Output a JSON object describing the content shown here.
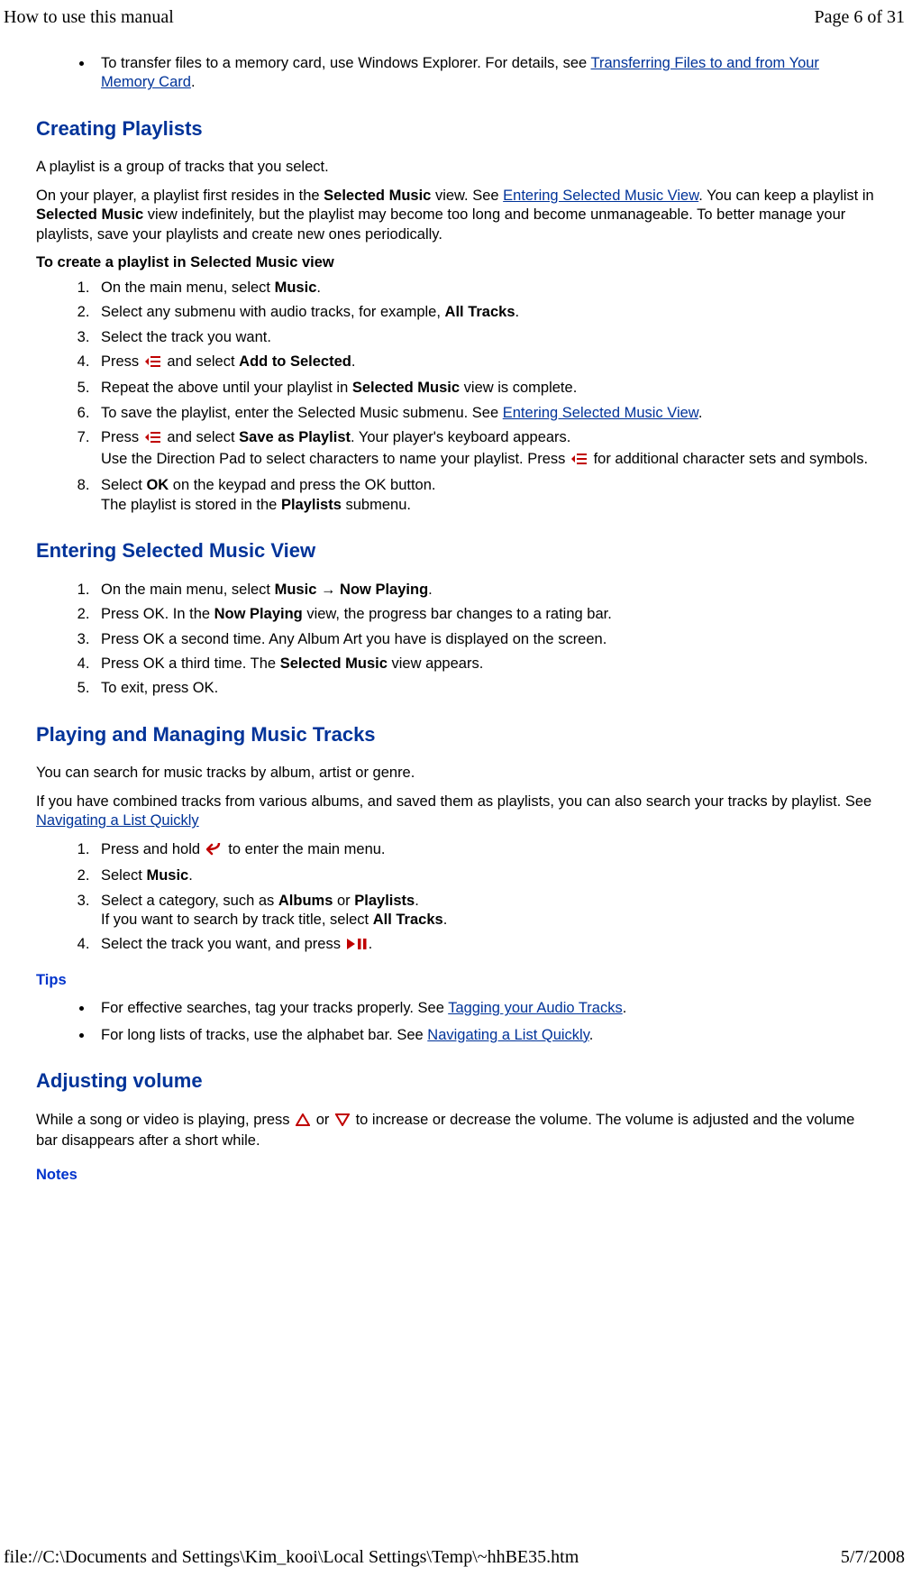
{
  "header": {
    "title": "How to use this manual",
    "page": "Page 6 of 31"
  },
  "footer": {
    "path": "file://C:\\Documents and Settings\\Kim_kooi\\Local Settings\\Temp\\~hhBE35.htm",
    "date": "5/7/2008"
  },
  "intro": {
    "memcard_pre": "To transfer files to a memory card, use Windows Explorer. For details, see ",
    "memcard_link": "Transferring Files to and from Your Memory Card",
    "memcard_post": "."
  },
  "creating": {
    "heading": "Creating Playlists",
    "p1": "A playlist is a group of tracks that you select.",
    "p2_a": "On your player, a playlist first resides in the ",
    "p2_b": "Selected Music",
    "p2_c": " view. See ",
    "p2_link": "Entering Selected Music View",
    "p2_d": ". You can keep a playlist in ",
    "p2_e": "Selected Music",
    "p2_f": " view indefinitely, but the playlist may become too long and become unmanageable. To better manage your playlists, save your playlists and create new ones periodically.",
    "howto": "To create a playlist in Selected Music view",
    "s1_a": "On the main menu, select ",
    "s1_b": "Music",
    "s1_c": ".",
    "s2_a": "Select any submenu with audio tracks, for example, ",
    "s2_b": "All Tracks",
    "s2_c": ".",
    "s3": "Select the track you want.",
    "s4_a": "Press ",
    "s4_b": " and select ",
    "s4_c": "Add to Selected",
    "s4_d": ".",
    "s5_a": "Repeat the above until your playlist in ",
    "s5_b": "Selected Music",
    "s5_c": " view is complete.",
    "s6_a": "To save the playlist, enter the Selected Music submenu. See ",
    "s6_link": "Entering Selected Music View",
    "s6_b": ".",
    "s7_a": "Press ",
    "s7_b": " and select ",
    "s7_c": "Save as Playlist",
    "s7_d": ". Your player's keyboard appears.",
    "s7_e": "Use the Direction Pad to select characters to name your playlist. Press ",
    "s7_f": " for additional character sets and symbols.",
    "s8_a": "Select ",
    "s8_b": "OK",
    "s8_c": " on the keypad and press the OK button.",
    "s8_d": "The playlist is stored in the ",
    "s8_e": "Playlists",
    "s8_f": " submenu."
  },
  "entering": {
    "heading": "Entering Selected Music View",
    "s1_a": "On the main menu, select ",
    "s1_b": "Music",
    "s1_arrow": " → ",
    "s1_c": "Now Playing",
    "s1_d": ".",
    "s2_a": "Press OK. In the ",
    "s2_b": "Now Playing",
    "s2_c": " view, the progress bar changes to a rating bar.",
    "s3": "Press OK a second time. Any Album Art you have is displayed on the screen.",
    "s4_a": "Press OK a third time. The ",
    "s4_b": "Selected Music",
    "s4_c": " view appears.",
    "s5": "To exit, press OK."
  },
  "playing": {
    "heading": "Playing and Managing Music Tracks",
    "p1": "You can search for music tracks by album, artist or genre.",
    "p2_a": "If you have combined tracks from various albums, and saved them as playlists, you can also search your tracks by playlist. See ",
    "p2_link": "Navigating a List Quickly",
    "s1_a": "Press and hold ",
    "s1_b": " to enter the main menu.",
    "s2_a": "Select ",
    "s2_b": "Music",
    "s2_c": ".",
    "s3_a": "Select a category, such as ",
    "s3_b": "Albums",
    "s3_c": " or ",
    "s3_d": "Playlists",
    "s3_e": ".",
    "s3_f": "If you want to search by track title, select ",
    "s3_g": "All Tracks",
    "s3_h": ".",
    "s4_a": "Select the track you want, and press ",
    "s4_b": ".",
    "tips_heading": "Tips",
    "tip1_a": "For effective searches, tag your tracks properly. See ",
    "tip1_link": "Tagging your Audio Tracks",
    "tip1_b": ".",
    "tip2_a": "For long lists of tracks, use the alphabet bar. See ",
    "tip2_link": "Navigating a List Quickly",
    "tip2_b": "."
  },
  "adjusting": {
    "heading": "Adjusting volume",
    "p1_a": "While a song or video is playing, press ",
    "p1_b": " or ",
    "p1_c": " to increase or decrease the volume. The volume is adjusted and the volume bar disappears after a short while.",
    "notes_heading": "Notes"
  }
}
